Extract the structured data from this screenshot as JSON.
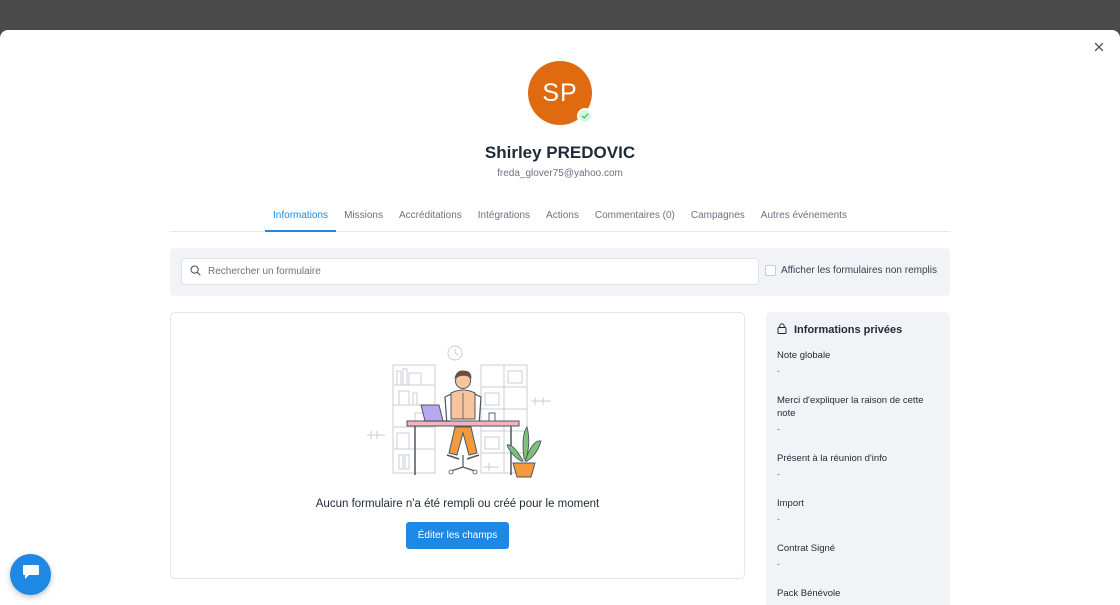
{
  "profile": {
    "initials": "SP",
    "name": "Shirley PREDOVIC",
    "email": "freda_glover75@yahoo.com",
    "avatar_color": "#e06a10"
  },
  "tabs": [
    {
      "label": "Informations",
      "active": true
    },
    {
      "label": "Missions",
      "active": false
    },
    {
      "label": "Accréditations",
      "active": false
    },
    {
      "label": "Intégrations",
      "active": false
    },
    {
      "label": "Actions",
      "active": false
    },
    {
      "label": "Commentaires (0)",
      "active": false
    },
    {
      "label": "Campagnes",
      "active": false
    },
    {
      "label": "Autres événements",
      "active": false
    }
  ],
  "search": {
    "placeholder": "Rechercher un formulaire",
    "show_unfilled_label": "Afficher les formulaires non remplis"
  },
  "empty_state": {
    "message": "Aucun formulaire n'a été rempli ou créé pour le moment",
    "button_label": "Éditer les champs"
  },
  "private_info": {
    "title": "Informations privées",
    "fields": [
      {
        "label": "Note globale",
        "value": "-"
      },
      {
        "label": "Merci d'expliquer la raison de cette note",
        "value": "-"
      },
      {
        "label": "Présent à la réunion d'info",
        "value": "-"
      },
      {
        "label": "Import",
        "value": "-"
      },
      {
        "label": "Contrat Signé",
        "value": "-"
      },
      {
        "label": "Pack Bénévole",
        "value": ""
      }
    ]
  },
  "colors": {
    "accent": "#1e88e5",
    "verified": "#2fb36d"
  }
}
